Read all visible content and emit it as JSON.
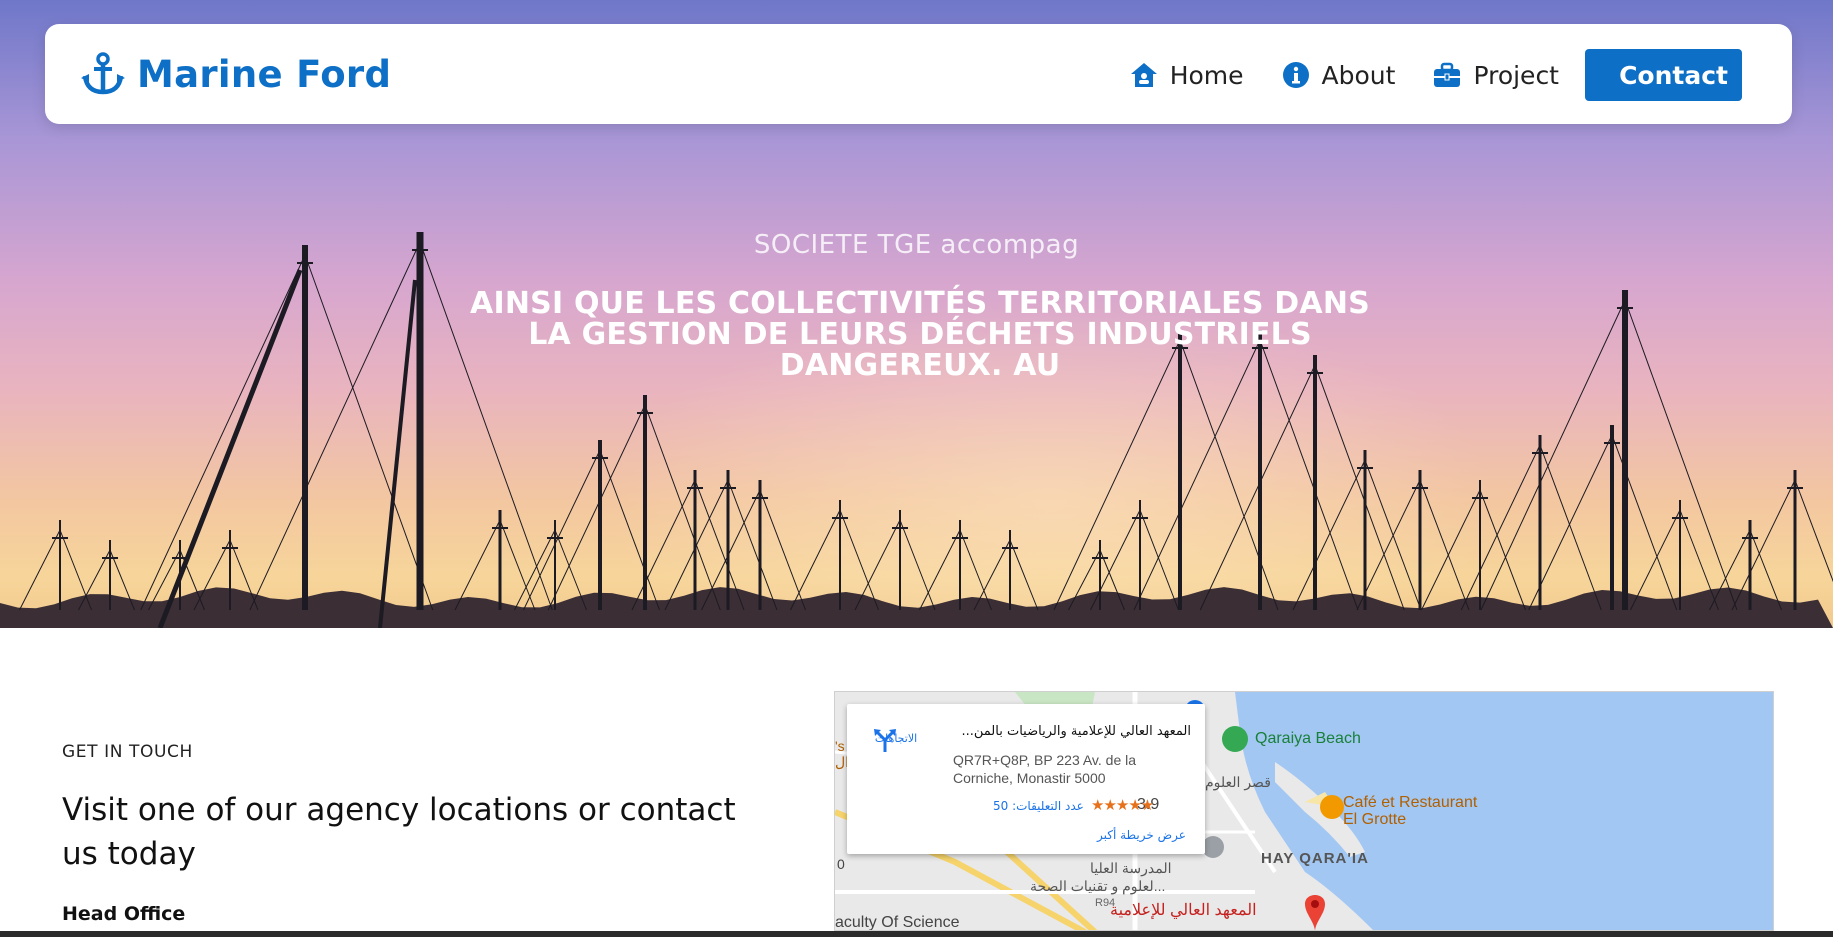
{
  "brand": {
    "name": "Marine Ford",
    "icon": "anchor-icon",
    "color": "#0d6fc6"
  },
  "nav": {
    "items": [
      {
        "label": "Home",
        "icon": "home-icon"
      },
      {
        "label": "About",
        "icon": "info-icon"
      },
      {
        "label": "Project",
        "icon": "briefcase-icon"
      }
    ],
    "contact_label": "Contact"
  },
  "hero": {
    "subtitle": "SOCIETE TGE accompag",
    "title": "AINSI QUE LES COLLECTIVITÉS TERRITORIALES DANS LA GESTION DE LEURS DÉCHETS INDUSTRIELS DANGEREUX. AU"
  },
  "contact": {
    "kicker": "GET IN TOUCH",
    "heading": "Visit one of our agency locations or contact us today",
    "office_label": "Head Office"
  },
  "map": {
    "place_name": "المعهد العالي للإعلامية والرياضيات بالمن...",
    "address": "QR7R+Q8P, BP 223 Av. de la Corniche, Monastir 5000",
    "rating": "3.9",
    "stars": "★★★★★",
    "reviews": "عدد التعليقات: 50",
    "larger_map": "عرض خريطة أكبر",
    "directions": "الاتجاهات",
    "labels": {
      "beach": "Qaraiya Beach",
      "cafe_line1": "Café et Restaurant",
      "cafe_line2": "El Grotte",
      "district": "HAY QARA'IA",
      "arabic_palace": "قصر العلوم",
      "arabic_school_1": "المدرسة العليا",
      "arabic_school_2": "لعلوم و تقنيات الصحة...",
      "faculty": "aculty Of Science",
      "marker_label": "المعهد العالي للإعلامية",
      "road": "R94",
      "left_edge_1": "'s",
      "left_edge_2": "ال",
      "zero": "0"
    }
  }
}
